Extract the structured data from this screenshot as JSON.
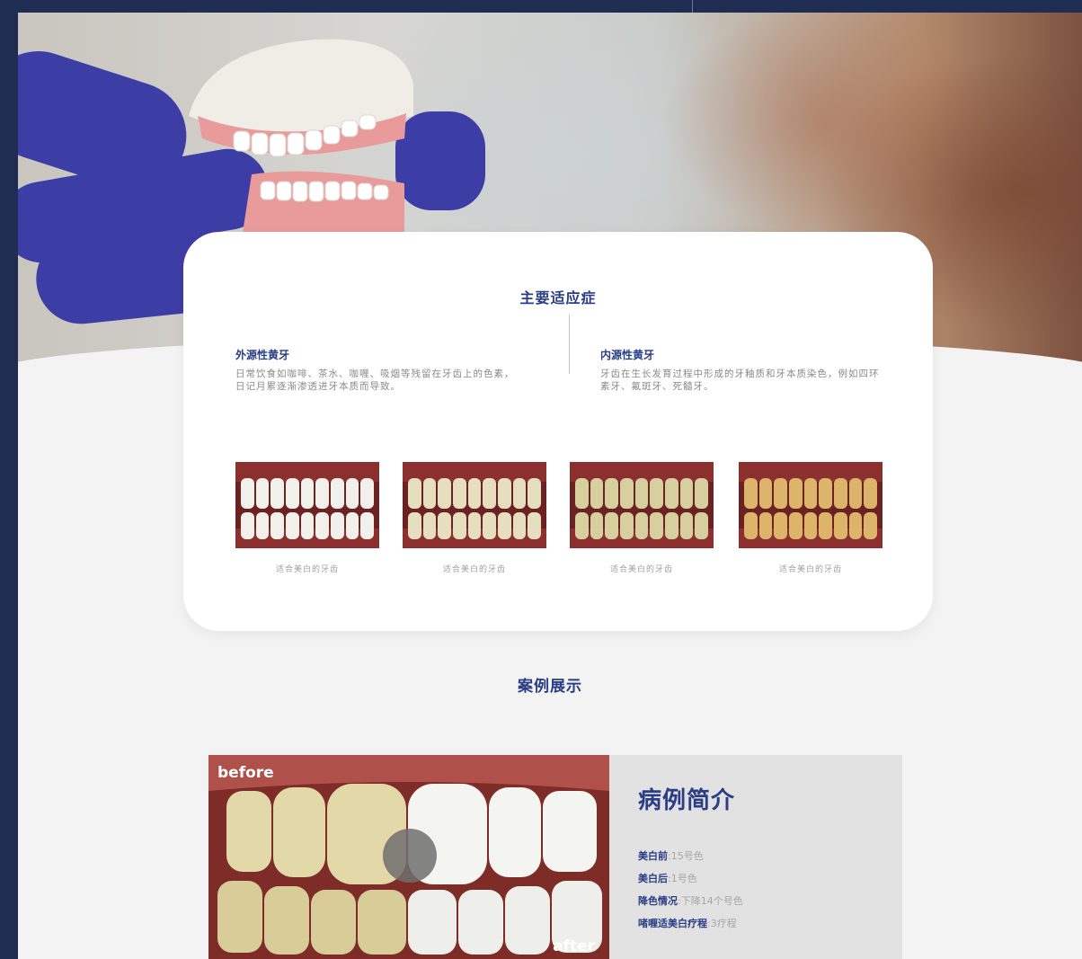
{
  "card": {
    "title": "主要适应症",
    "left": {
      "title": "外源性黄牙",
      "text": "日常饮食如咖啡、茶水、咖喱、吸烟等残留在牙齿上的色素，日记月累逐渐渗透进牙本质而导致。"
    },
    "right": {
      "title": "内源性黄牙",
      "text": "牙齿在生长发育过程中形成的牙釉质和牙本质染色，例如四环素牙、氟斑牙、死髓牙。"
    },
    "thumbs": [
      {
        "caption": "适合美白的牙齿",
        "tooth_color": "#f1f0ea"
      },
      {
        "caption": "适合美白的牙齿",
        "tooth_color": "#e6dfbf"
      },
      {
        "caption": "适合美白的牙齿",
        "tooth_color": "#d8cf9e"
      },
      {
        "caption": "适合美白的牙齿",
        "tooth_color": "#dcb56a"
      }
    ]
  },
  "section": {
    "title": "案例展示"
  },
  "case": {
    "before_label": "before",
    "after_label": "after",
    "title": "病例简介",
    "items": [
      {
        "label": "美白前",
        "value": ":15号色"
      },
      {
        "label": "美白后",
        "value": ":1号色"
      },
      {
        "label": "降色情况",
        "value": ":下降14个号色"
      },
      {
        "label": "啫喱适美白疗程",
        "value": ":3疗程"
      }
    ]
  },
  "colors": {
    "navy": "#1f2d52",
    "accent_blue": "#2a3d85",
    "glove": "#3d3da6"
  }
}
